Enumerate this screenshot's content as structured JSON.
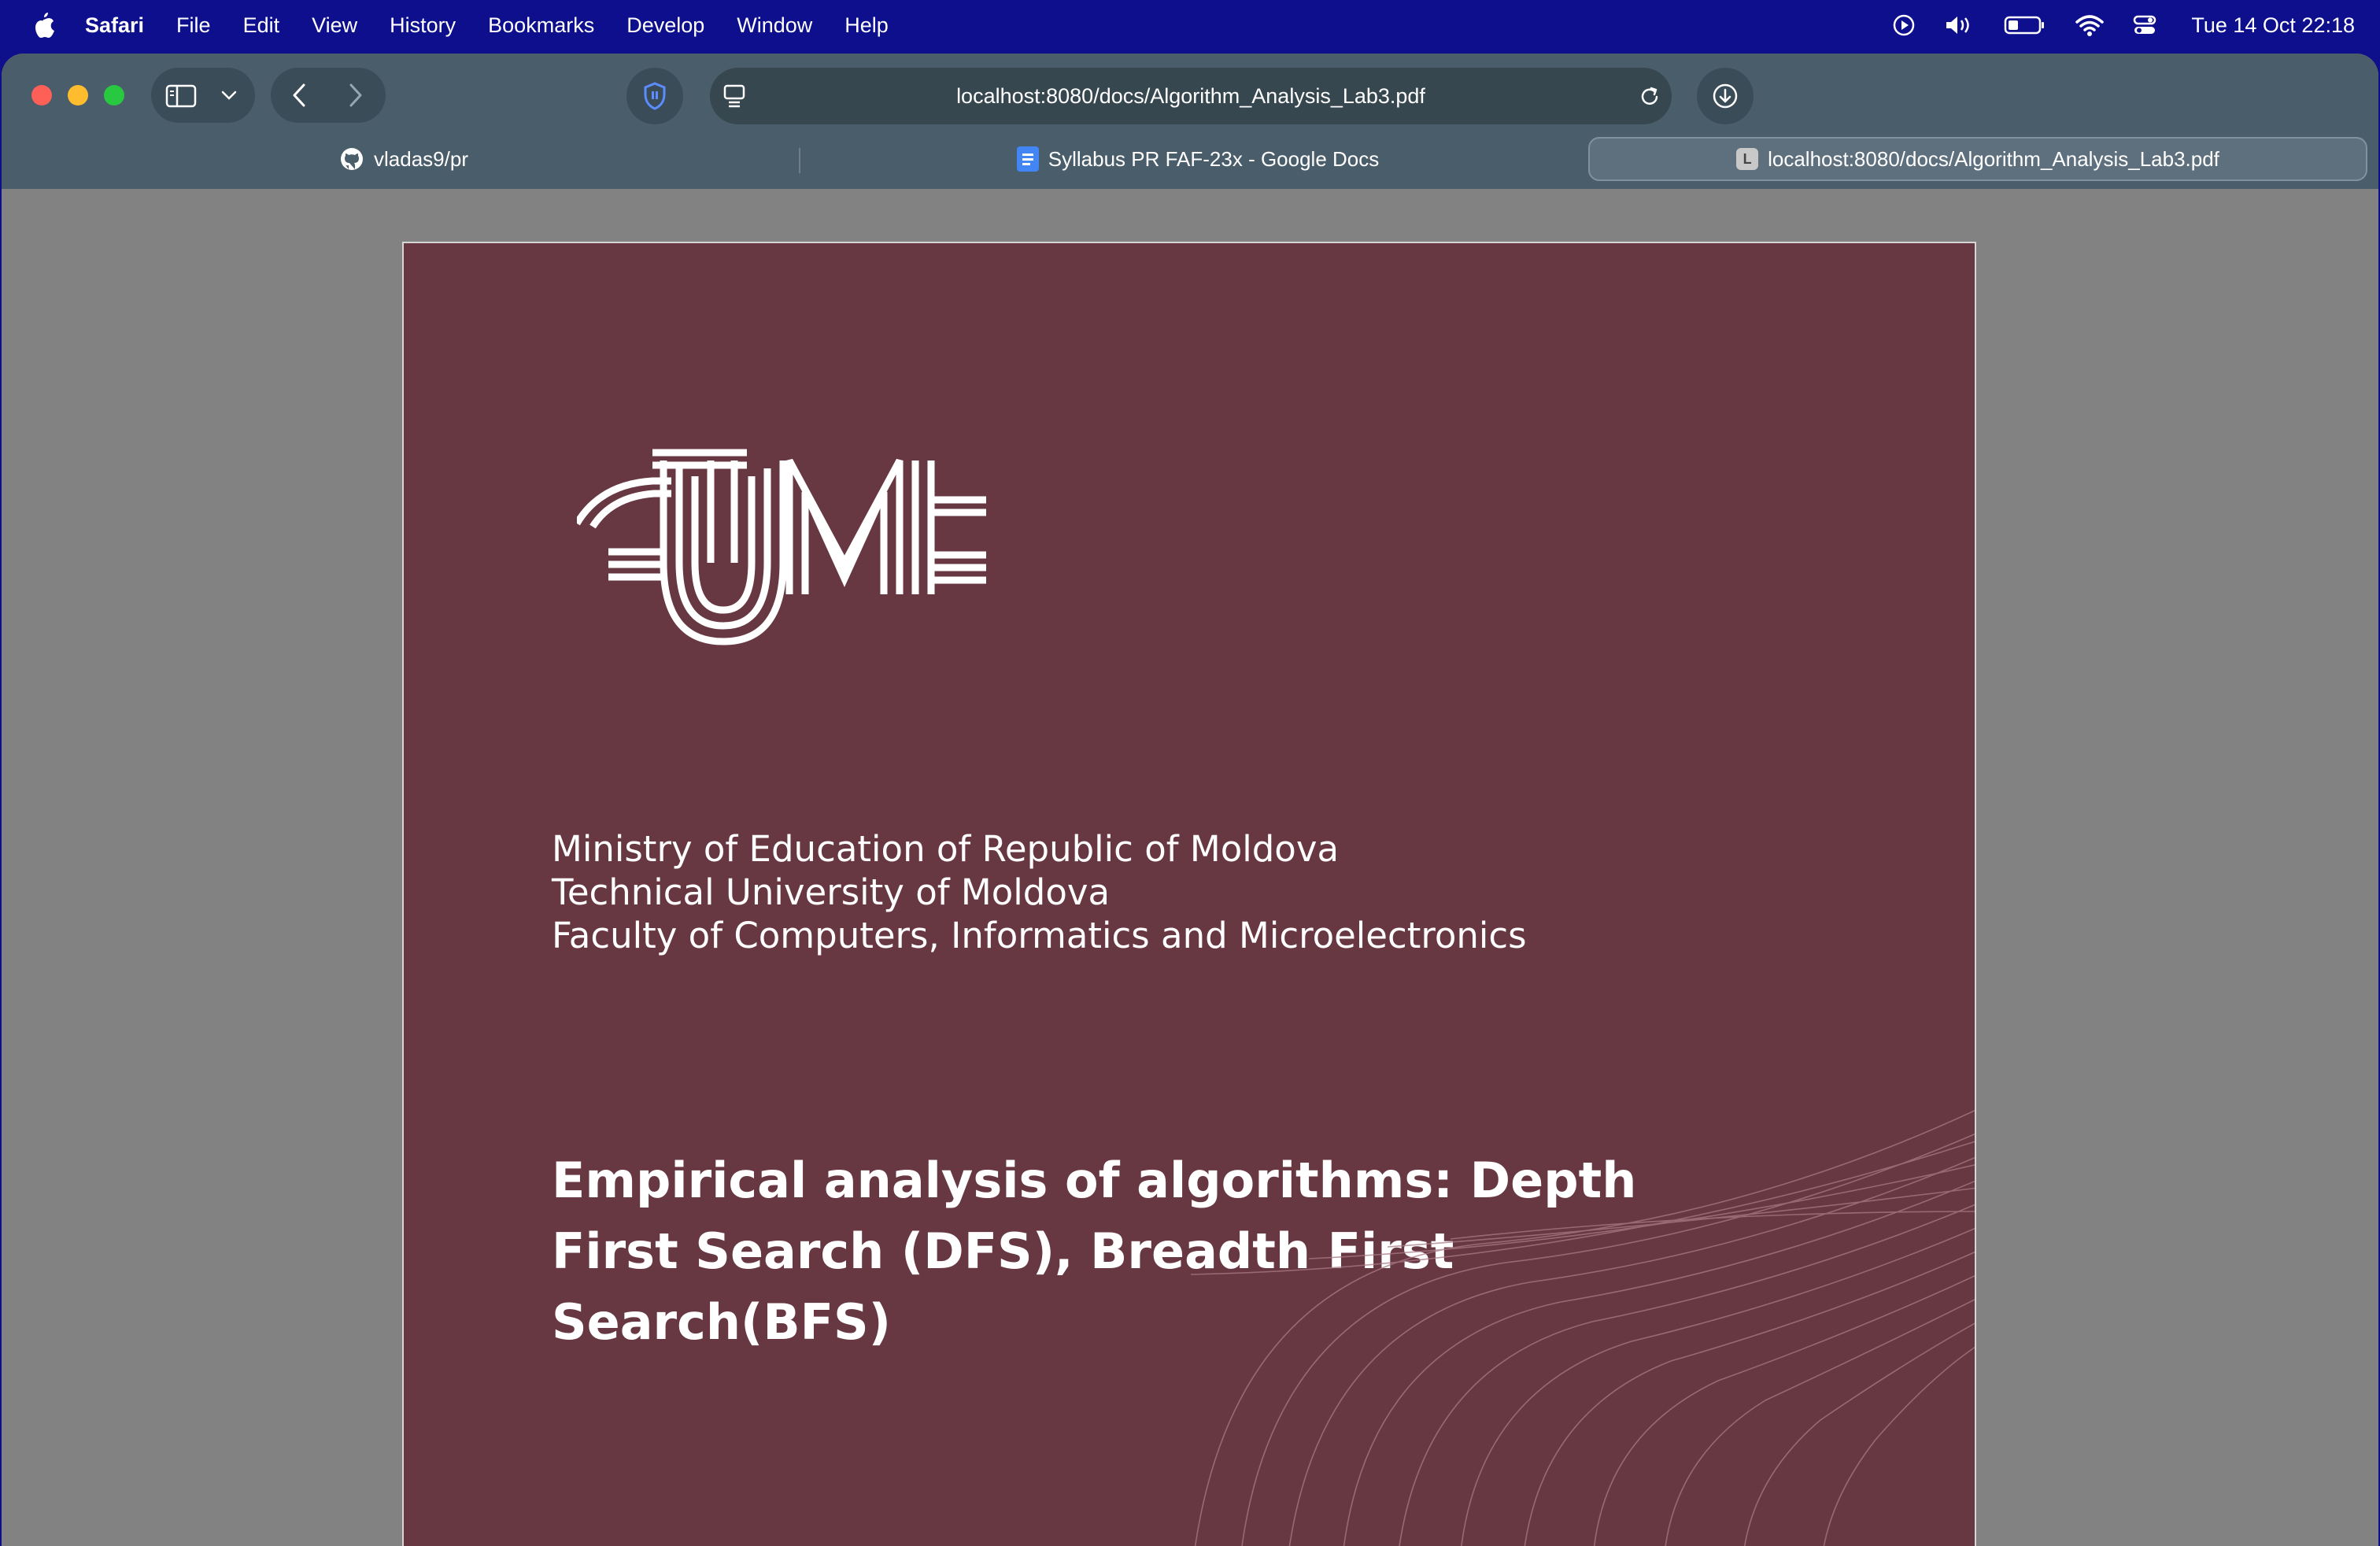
{
  "menubar": {
    "app_name": "Safari",
    "menus": [
      "File",
      "Edit",
      "View",
      "History",
      "Bookmarks",
      "Develop",
      "Window",
      "Help"
    ],
    "clock": "Tue 14 Oct  22:18",
    "status_icons": [
      "now-playing-icon",
      "volume-icon",
      "battery-icon",
      "wifi-icon",
      "control-center-icon"
    ]
  },
  "toolbar": {
    "url": "localhost:8080/docs/Algorithm_Analysis_Lab3.pdf"
  },
  "tabs": [
    {
      "label": "vladas9/pr",
      "icon": "github-icon",
      "active": false
    },
    {
      "label": "Syllabus PR FAF-23x - Google Docs",
      "icon": "google-docs-icon",
      "active": false
    },
    {
      "label": "localhost:8080/docs/Algorithm_Analysis_Lab3.pdf",
      "icon": "letter-l-icon",
      "favicon_letter": "L",
      "active": true
    }
  ],
  "document": {
    "logo_text": "UTM",
    "institution_lines": [
      "Ministry of Education of Republic of Moldova",
      "Technical University of Moldova",
      "Faculty of Computers, Informatics and Microelectronics"
    ],
    "title_lines": [
      "Empirical analysis of algorithms: Depth",
      "First Search (DFS), Breadth First",
      "Search(BFS)"
    ]
  },
  "colors": {
    "menubar": "#0d0f8c",
    "toolbar": "#4a5d6b",
    "page_background": "#683842",
    "viewer_background": "#828282"
  }
}
